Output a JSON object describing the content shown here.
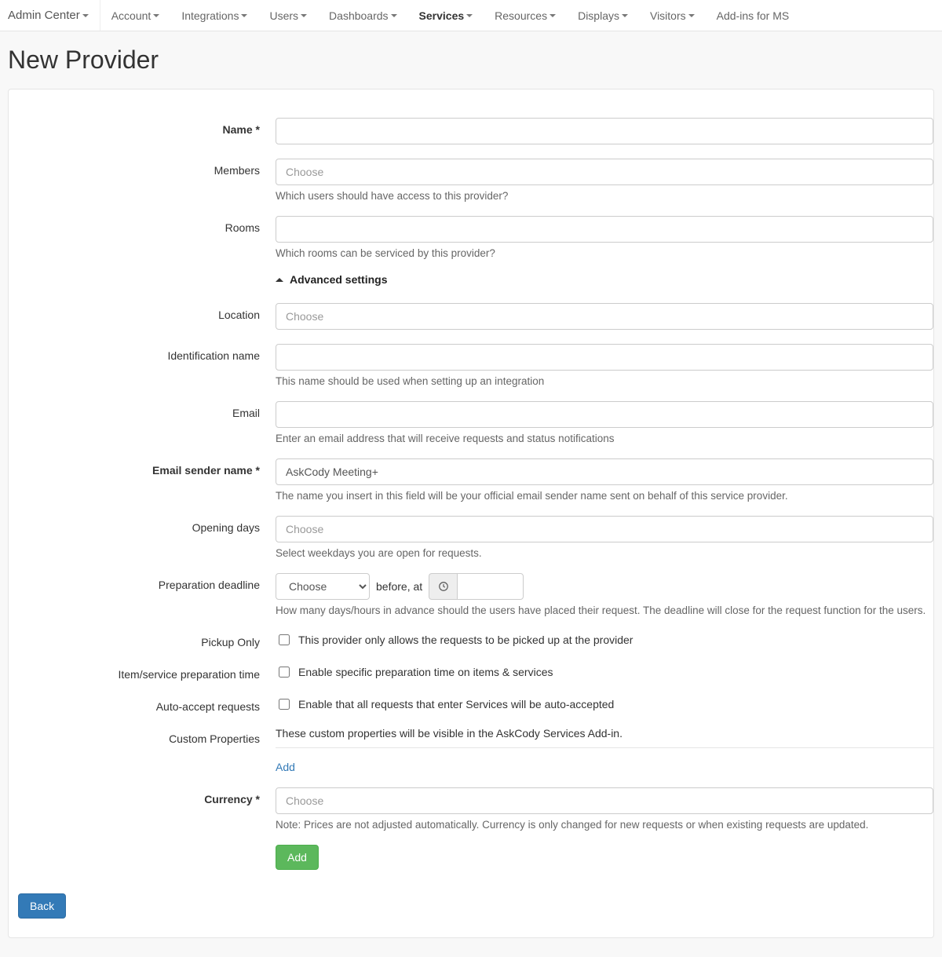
{
  "nav": {
    "brand": "Admin Center",
    "items": [
      {
        "label": "Account",
        "caret": true,
        "active": false
      },
      {
        "label": "Integrations",
        "caret": true,
        "active": false
      },
      {
        "label": "Users",
        "caret": true,
        "active": false
      },
      {
        "label": "Dashboards",
        "caret": true,
        "active": false
      },
      {
        "label": "Services",
        "caret": true,
        "active": true
      },
      {
        "label": "Resources",
        "caret": true,
        "active": false
      },
      {
        "label": "Displays",
        "caret": true,
        "active": false
      },
      {
        "label": "Visitors",
        "caret": true,
        "active": false
      },
      {
        "label": "Add-ins for MS",
        "caret": false,
        "active": false
      }
    ]
  },
  "page": {
    "title": "New Provider"
  },
  "form": {
    "name": {
      "label": "Name *",
      "value": ""
    },
    "members": {
      "label": "Members",
      "placeholder": "Choose",
      "help": "Which users should have access to this provider?"
    },
    "rooms": {
      "label": "Rooms",
      "value": "",
      "help": "Which rooms can be serviced by this provider?"
    },
    "advanced_header": "Advanced settings",
    "location": {
      "label": "Location",
      "placeholder": "Choose"
    },
    "identification": {
      "label": "Identification name",
      "value": "",
      "help": "This name should be used when setting up an integration"
    },
    "email": {
      "label": "Email",
      "value": "",
      "help": "Enter an email address that will receive requests and status notifications"
    },
    "email_sender": {
      "label": "Email sender name *",
      "value": "AskCody Meeting+",
      "help": "The name you insert in this field will be your official email sender name sent on behalf of this service provider."
    },
    "opening_days": {
      "label": "Opening days",
      "placeholder": "Choose",
      "help": "Select weekdays you are open for requests."
    },
    "prep_deadline": {
      "label": "Preparation deadline",
      "select_placeholder": "Choose",
      "before_at": "before, at",
      "time_value": "",
      "help": "How many days/hours in advance should the users have placed their request. The deadline will close for the request function for the users."
    },
    "pickup_only": {
      "label": "Pickup Only",
      "checkbox_label": "This provider only allows the requests to be picked up at the provider",
      "checked": false
    },
    "prep_time": {
      "label": "Item/service preparation time",
      "checkbox_label": "Enable specific preparation time on items & services",
      "checked": false
    },
    "auto_accept": {
      "label": "Auto-accept requests",
      "checkbox_label": "Enable that all requests that enter Services will be auto-accepted",
      "checked": false
    },
    "custom_props": {
      "label": "Custom Properties",
      "help": "These custom properties will be visible in the AskCody Services Add-in.",
      "add_link": "Add"
    },
    "currency": {
      "label": "Currency *",
      "placeholder": "Choose",
      "help": "Note: Prices are not adjusted automatically. Currency is only changed for new requests or when existing requests are updated."
    },
    "add_button": "Add"
  },
  "footer": {
    "back": "Back"
  }
}
